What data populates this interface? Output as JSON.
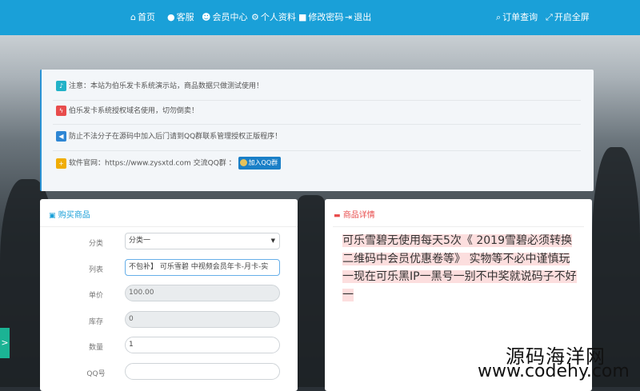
{
  "nav": {
    "home": "首页",
    "service": "客服",
    "member": "会员中心",
    "profile": "个人资料",
    "password": "修改密码",
    "logout": "退出",
    "order_query": "订单查询",
    "fullscreen": "开启全屏"
  },
  "notice": {
    "line1": "注意：本站为伯乐发卡系统演示站，商品数据只做测试使用！",
    "line2": "伯乐发卡系统授权域名使用，切勿倒卖！",
    "line3": "防止不法分子在源码中加入后门请到QQ群联系管理授权正版程序！",
    "line4": "软件官网：https://www.zysxtd.com 交流QQ群 ：",
    "qq_button": "加入QQ群"
  },
  "buy": {
    "title": "购买商品",
    "category_label": "分类",
    "category_value": "分类一",
    "list_label": "列表",
    "list_value": "不包补】 可乐雪碧 中视频会员年卡-月卡-实",
    "price_label": "单价",
    "price_value": "100.00",
    "stock_label": "库存",
    "stock_value": "0",
    "qty_label": "数量",
    "qty_value": "1",
    "qq_label": "QQ号",
    "qq_value": ""
  },
  "detail": {
    "title": "商品详情",
    "text": "可乐雪碧无使用每天5次《 2019雪碧必须转换二维码中会员优惠卷等》 实物等不必中谨慎玩一现在可乐黑IP一黑号一别不中奖就说码子不好一"
  },
  "sidetab": ">",
  "watermark": {
    "line1": "源码海洋网",
    "line2": "www.codehy.com"
  },
  "colors": {
    "nav_bg": "#1aa0d8",
    "notice_border": "#2a93d5",
    "icon_info": "#22b2c8",
    "icon_warning": "#e84c4c",
    "icon_shield": "#2e86d4",
    "icon_plus": "#f0ad05",
    "side_tab": "#1bb394"
  }
}
